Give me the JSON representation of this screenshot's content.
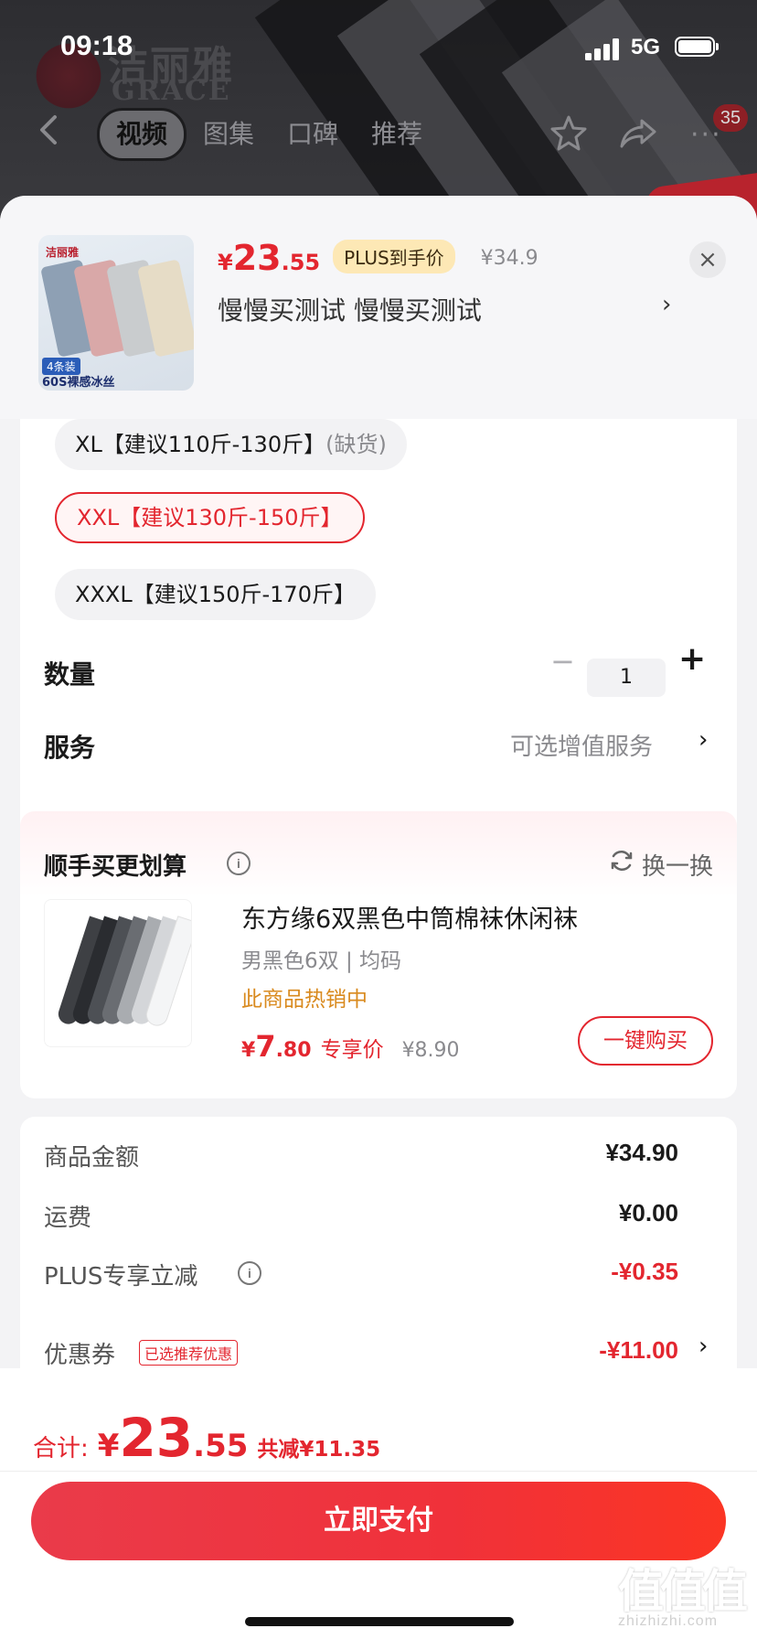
{
  "status_bar": {
    "time": "09:18",
    "network": "5G"
  },
  "background": {
    "brand_cn": "洁丽雅",
    "brand_en": "GRACE"
  },
  "nav": {
    "tabs": [
      {
        "label": "视频",
        "active": true
      },
      {
        "label": "图集",
        "active": false
      },
      {
        "label": "口碑",
        "active": false
      },
      {
        "label": "推荐",
        "active": false
      }
    ],
    "badge_count": "35"
  },
  "product": {
    "thumb_logo": "洁丽雅",
    "thumb_tag1": "4条装",
    "thumb_tag2": "60S裸感冰丝",
    "price_yen": "¥",
    "price_int": "23",
    "price_dec": ".55",
    "plus_tag": "PLUS到手价",
    "original_price": "¥34.9",
    "sku_name": "慢慢买测试  慢慢买测试",
    "close_icon": "×"
  },
  "sizes": [
    {
      "label": "XL【建议110斤-130斤】",
      "note": "(缺货)",
      "selected": false
    },
    {
      "label": "XXL【建议130斤-150斤】",
      "note": "",
      "selected": true
    },
    {
      "label": "XXXL【建议150斤-170斤】",
      "note": "",
      "selected": false
    }
  ],
  "quantity": {
    "label": "数量",
    "value": "1",
    "minus": "−",
    "plus": "+"
  },
  "service": {
    "label": "服务",
    "value": "可选增值服务"
  },
  "bundle": {
    "title": "顺手买更划算",
    "refresh_label": "换一换",
    "name": "东方缘6双黑色中筒棉袜休闲袜",
    "spec": "男黑色6双  |  均码",
    "hot": "此商品热销中",
    "price_yen": "¥",
    "price_int": "7",
    "price_dec": ".80",
    "price_tag": "专享价",
    "original_price": "¥8.90",
    "buy_label": "一键购买"
  },
  "summary": {
    "rows": [
      {
        "label": "商品金额",
        "value": "¥34.90"
      },
      {
        "label": "运费",
        "value": "¥0.00"
      },
      {
        "label": "PLUS专享立减",
        "value": "-¥0.35"
      },
      {
        "label": "优惠券",
        "value": "-¥11.00"
      }
    ],
    "coupon_tag": "已选推荐优惠"
  },
  "footer": {
    "total_label": "合计:",
    "total_yen": "¥",
    "total_int": "23",
    "total_dec": ".55",
    "total_saved": "共减¥11.35",
    "pay_label": "立即支付"
  },
  "watermark": {
    "main": "值值值",
    "sub": "zhizhizhi.com"
  },
  "colors": {
    "accent": "#e3262f",
    "plus_tag_bg": "#fde8b5",
    "hot_text": "#d98a1e"
  }
}
